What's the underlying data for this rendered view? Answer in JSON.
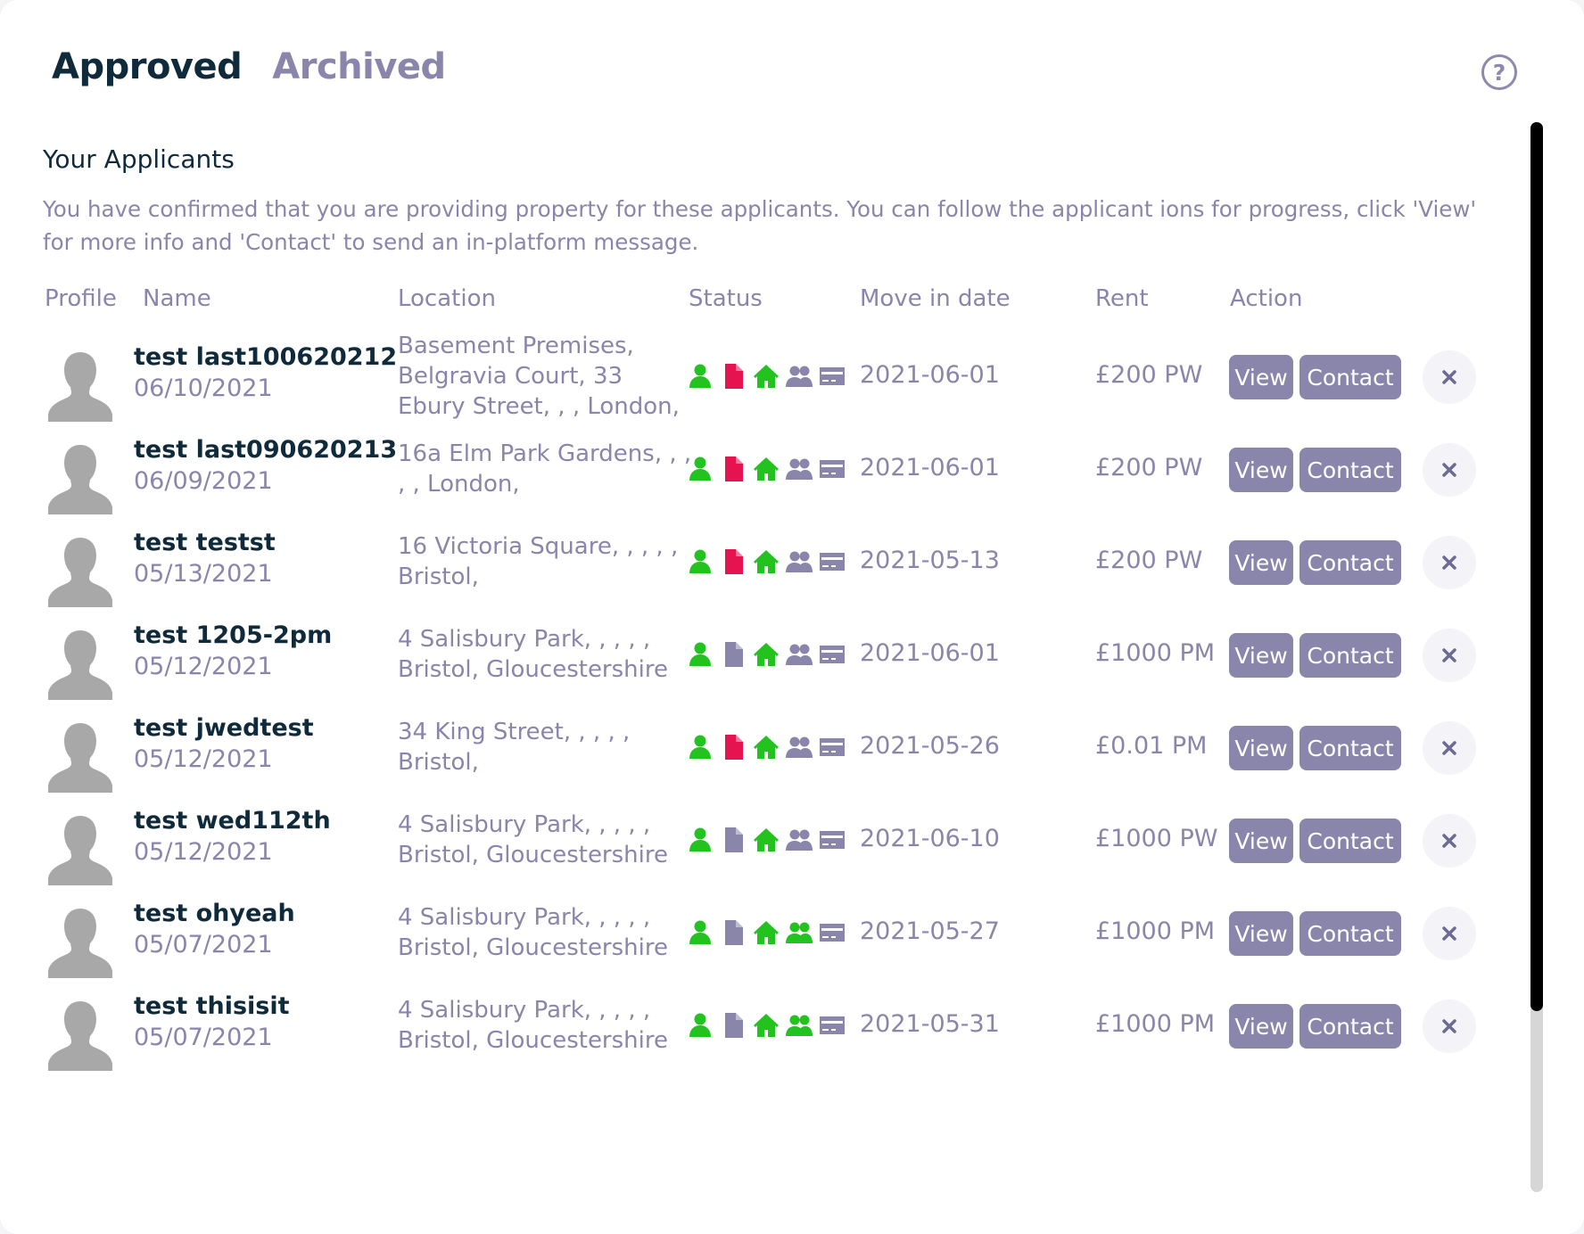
{
  "tabs": {
    "approved": "Approved",
    "archived": "Archived"
  },
  "help": {
    "glyph": "?"
  },
  "section": {
    "title": "Your Applicants",
    "description": "You have confirmed that you are providing property for these applicants. You can follow the applicant ions for progress, click 'View' for more info and 'Contact' to send an in-platform message."
  },
  "table": {
    "headers": {
      "profile": "Profile",
      "name": "Name",
      "location": "Location",
      "status": "Status",
      "move_in": "Move in date",
      "rent": "Rent",
      "action": "Action"
    },
    "buttons": {
      "view": "View",
      "contact": "Contact"
    },
    "status_colors": {
      "active": "#22c21f",
      "inactive": "#8a85aa",
      "alert": "#e5134f"
    },
    "status_icons": [
      "person-icon",
      "document-icon",
      "house-icon",
      "people-icon",
      "card-icon"
    ],
    "rows": [
      {
        "name": "test last100620212",
        "date": "06/10/2021",
        "location": "Basement Premises, Belgravia Court, 33 Ebury Street, , , London,",
        "status": [
          "active",
          "alert",
          "active",
          "inactive",
          "inactive"
        ],
        "move_in": "2021-06-01",
        "rent": "£200 PW"
      },
      {
        "name": "test last090620213",
        "date": "06/09/2021",
        "location": "16a Elm Park Gardens, , , , , London,",
        "status": [
          "active",
          "alert",
          "active",
          "inactive",
          "inactive"
        ],
        "move_in": "2021-06-01",
        "rent": "£200 PW"
      },
      {
        "name": "test testst",
        "date": "05/13/2021",
        "location": "16 Victoria Square, , , , , Bristol,",
        "status": [
          "active",
          "alert",
          "active",
          "inactive",
          "inactive"
        ],
        "move_in": "2021-05-13",
        "rent": "£200 PW"
      },
      {
        "name": "test 1205-2pm",
        "date": "05/12/2021",
        "location": "4 Salisbury Park, , , , , Bristol, Gloucestershire",
        "status": [
          "active",
          "inactive",
          "active",
          "inactive",
          "inactive"
        ],
        "move_in": "2021-06-01",
        "rent": "£1000 PM"
      },
      {
        "name": "test jwedtest",
        "date": "05/12/2021",
        "location": "34 King Street, , , , , Bristol,",
        "status": [
          "active",
          "alert",
          "active",
          "inactive",
          "inactive"
        ],
        "move_in": "2021-05-26",
        "rent": "£0.01 PM"
      },
      {
        "name": "test wed112th",
        "date": "05/12/2021",
        "location": "4 Salisbury Park, , , , , Bristol, Gloucestershire",
        "status": [
          "active",
          "inactive",
          "active",
          "inactive",
          "inactive"
        ],
        "move_in": "2021-06-10",
        "rent": "£1000 PW"
      },
      {
        "name": "test ohyeah",
        "date": "05/07/2021",
        "location": "4 Salisbury Park, , , , , Bristol, Gloucestershire",
        "status": [
          "active",
          "inactive",
          "active",
          "active",
          "inactive"
        ],
        "move_in": "2021-05-27",
        "rent": "£1000 PM"
      },
      {
        "name": "test thisisit",
        "date": "05/07/2021",
        "location": "4 Salisbury Park, , , , , Bristol, Gloucestershire",
        "status": [
          "active",
          "inactive",
          "active",
          "active",
          "inactive"
        ],
        "move_in": "2021-05-31",
        "rent": "£1000 PM"
      }
    ]
  }
}
